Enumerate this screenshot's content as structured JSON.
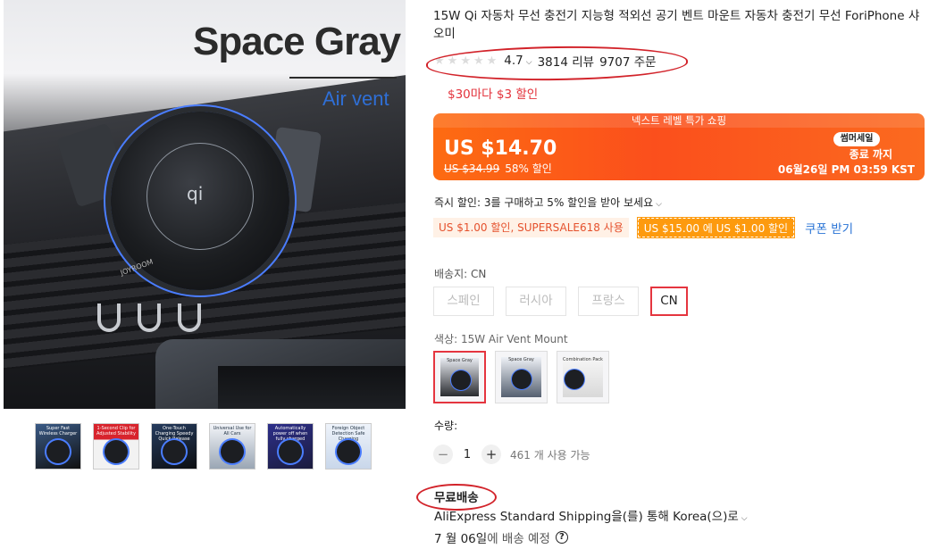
{
  "gallery": {
    "hero": {
      "title": "Space Gray",
      "subtitle": "Air vent",
      "brand": "JOYROOM",
      "qi": "qi"
    },
    "thumbnails": [
      {
        "caption": "Super Fast Wireless Charger",
        "bg": "#2a3d5c"
      },
      {
        "caption": "1-Second Clip for Adjusted Stability",
        "bg": "#c8202a"
      },
      {
        "caption": "One-Touch Charging Speedy Quick Release",
        "bg": "#1c2f4a"
      },
      {
        "caption": "Universal Use for All Cars",
        "bg": "#e8edf4"
      },
      {
        "caption": "Automatically power off when fully charged",
        "bg": "#2a2a66"
      },
      {
        "caption": "Foreign Object Detection Safe Charging",
        "bg": "#e6eef8"
      }
    ]
  },
  "product": {
    "title": "15W Qi 자동차 무선 충전기 지능형 적외선 공기 벤트 마운트 자동차 충전기 무선 ForiPhone 샤오미",
    "rating": "4.7",
    "reviews": "3814 리뷰",
    "orders": "9707 주문"
  },
  "promo": {
    "coupon_line": "$30마다 $3 할인"
  },
  "deal": {
    "banner": "넥스트 레벨 특가 쇼핑",
    "price": "US $14.70",
    "original_price": "US $34.99",
    "discount": "58% 할인",
    "badge": "썸머세일",
    "ends_label": "종료 까지",
    "end_time": "06월26일 PM 03:59 KST"
  },
  "instant_discount": {
    "prefix": "즉시 할인: ",
    "text": "3를 구매하고 5% 할인을 받아 보세요",
    "coupon_a": "US $1.00 할인, SUPERSALE618 사용",
    "coupon_b": "US $15.00 에 US $1.00 할인",
    "get_coupon": "쿠폰 받기"
  },
  "ship_from": {
    "label": "배송지: ",
    "value": "CN",
    "options": [
      "스페인",
      "러시아",
      "프랑스",
      "CN"
    ]
  },
  "color": {
    "label": "색상: ",
    "value": "15W Air Vent Mount",
    "swatches": [
      "Space Gray",
      "Space Gray",
      "Combination Pack"
    ]
  },
  "quantity": {
    "label": "수량:",
    "value": "1",
    "minus": "−",
    "plus": "+",
    "available": "461 개 사용 가능"
  },
  "shipping": {
    "free": "무료배송",
    "method": "AliExpress Standard Shipping을(를) 통해 Korea(으)로",
    "eta_date": "7 월 06일",
    "eta_suffix": "에 배송 예정",
    "help": "?"
  },
  "colors": {
    "accent_red": "#e5353f",
    "deal_orange": "#fb4f1c",
    "link_blue": "#2a74d6",
    "annotation_red": "#d2232a"
  }
}
